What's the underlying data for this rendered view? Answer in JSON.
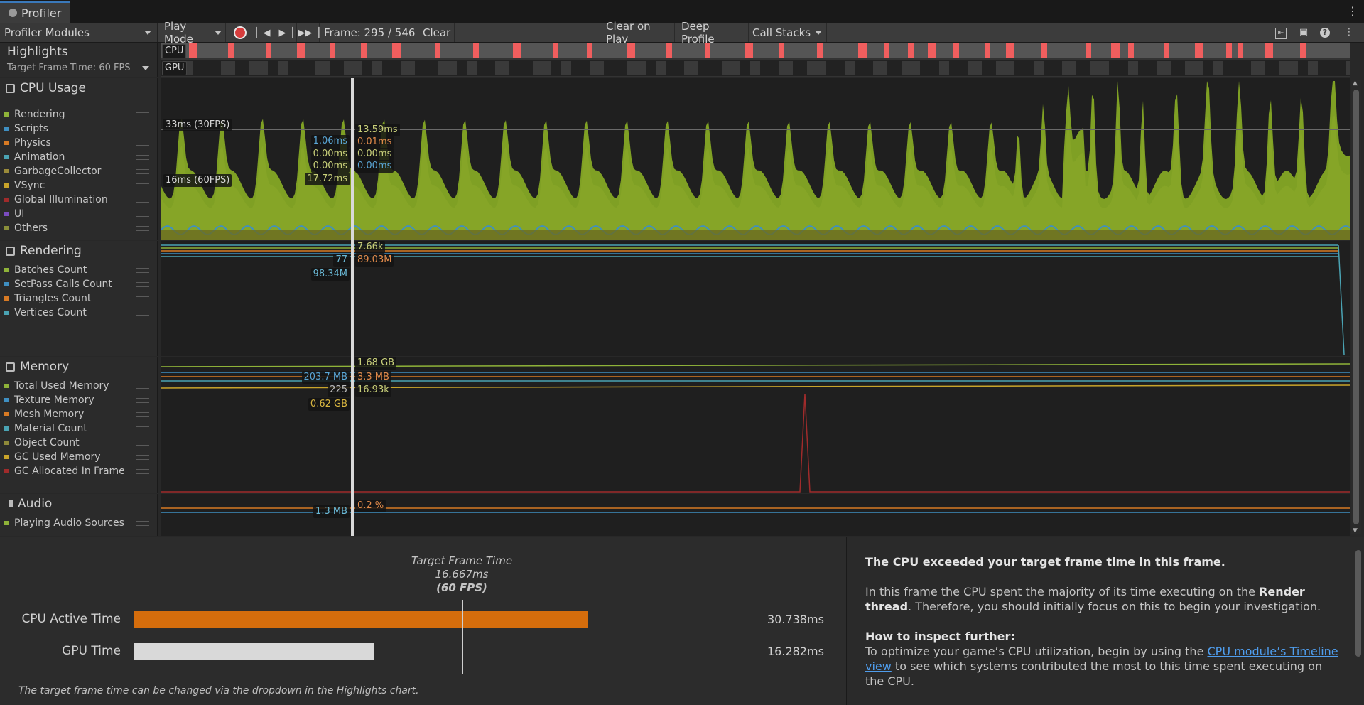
{
  "tab": {
    "title": "Profiler"
  },
  "toolbar": {
    "modules_dropdown": "Profiler Modules",
    "play_mode": "Play Mode",
    "frame": "Frame: 295 / 546",
    "clear": "Clear",
    "clear_on_play": "Clear on Play",
    "deep_profile": "Deep Profile",
    "call_stacks": "Call Stacks"
  },
  "highlights": {
    "title": "Highlights",
    "target": "Target Frame Time: 60 FPS",
    "cpu_label": "CPU",
    "gpu_label": "GPU"
  },
  "cpu_usage": {
    "title": "CPU Usage",
    "legend": [
      {
        "label": "Rendering",
        "color": "#8fb339"
      },
      {
        "label": "Scripts",
        "color": "#3f8fc1"
      },
      {
        "label": "Physics",
        "color": "#d77a24"
      },
      {
        "label": "Animation",
        "color": "#4aa3b3"
      },
      {
        "label": "GarbageCollector",
        "color": "#9b8b3a"
      },
      {
        "label": "VSync",
        "color": "#c9a42a"
      },
      {
        "label": "Global Illumination",
        "color": "#a02b2b"
      },
      {
        "label": "UI",
        "color": "#7b4cbf"
      },
      {
        "label": "Others",
        "color": "#8a8f3a"
      }
    ],
    "marker_30": "33ms (30FPS)",
    "marker_60": "16ms (60FPS)",
    "left_values": [
      "1.06ms",
      "0.00ms",
      "0.00ms",
      "17.72ms"
    ],
    "right_values": [
      "13.59ms",
      "0.01ms",
      "0.00ms",
      "0.00ms"
    ]
  },
  "rendering": {
    "title": "Rendering",
    "legend": [
      {
        "label": "Batches Count",
        "color": "#8fb339"
      },
      {
        "label": "SetPass Calls Count",
        "color": "#3f8fc1"
      },
      {
        "label": "Triangles Count",
        "color": "#d77a24"
      },
      {
        "label": "Vertices Count",
        "color": "#4aa3b3"
      }
    ],
    "left_values": [
      "77",
      "98.34M"
    ],
    "right_values": [
      "7.66k",
      "89.03M"
    ]
  },
  "memory": {
    "title": "Memory",
    "legend": [
      {
        "label": "Total Used Memory",
        "color": "#8fb339"
      },
      {
        "label": "Texture Memory",
        "color": "#3f8fc1"
      },
      {
        "label": "Mesh Memory",
        "color": "#d77a24"
      },
      {
        "label": "Material Count",
        "color": "#4aa3b3"
      },
      {
        "label": "Object Count",
        "color": "#8f8a3a"
      },
      {
        "label": "GC Used Memory",
        "color": "#c9a42a"
      },
      {
        "label": "GC Allocated In Frame",
        "color": "#a02b2b"
      }
    ],
    "left_values": [
      "203.7 MB",
      "225",
      "0.62 GB"
    ],
    "right_values": [
      "1.68 GB",
      "3.3 MB",
      "16.93k"
    ]
  },
  "audio": {
    "title": "Audio",
    "legend": [
      {
        "label": "Playing Audio Sources",
        "color": "#8fb339"
      }
    ],
    "left_values": [
      "1.3 MB"
    ],
    "right_values": [
      "0.2 %"
    ]
  },
  "bottom": {
    "target_title": "Target Frame Time",
    "target_ms": "16.667ms",
    "target_fps": "(60 FPS)",
    "cpu_label": "CPU Active Time",
    "cpu_value": "30.738ms",
    "cpu_fraction": 0.7458,
    "gpu_label": "GPU Time",
    "gpu_value": "16.282ms",
    "gpu_fraction": 0.395,
    "hint": "The target frame time can be changed via the dropdown in the Highlights chart.",
    "info_heading": "The CPU exceeded your target frame time in this frame.",
    "info_p1_a": "In this frame the CPU spent the majority of its time executing on the ",
    "info_p1_bold": "Render thread",
    "info_p1_b": ". Therefore, you should initially focus on this to begin your investigation.",
    "inspect_heading": "How to inspect further:",
    "inspect_a": "To optimize your game’s CPU utilization, begin by using the ",
    "inspect_link": "CPU module’s Timeline view",
    "inspect_b": " to see which systems contributed the most to this time spent executing on the CPU."
  },
  "colors": {
    "accent": "#3a79bb",
    "cpu_bar": "#d56d0c",
    "gpu_bar": "#d9d9d9",
    "highlight_red": "#f05e5e"
  }
}
